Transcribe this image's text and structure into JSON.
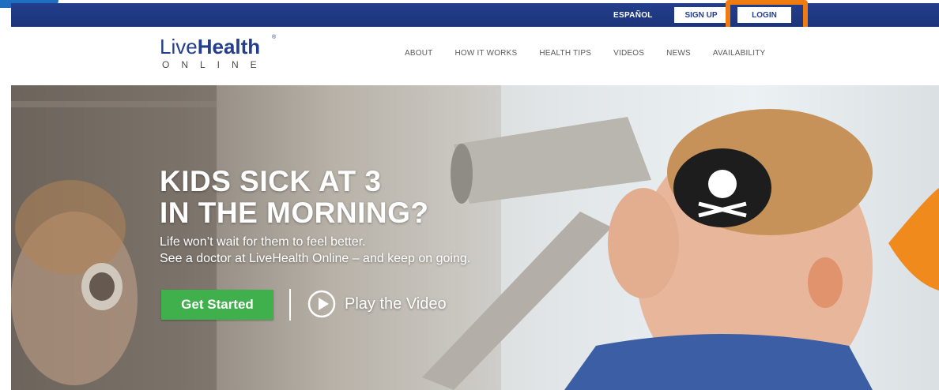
{
  "utility": {
    "espanol": "ESPAÑOL",
    "signup": "SIGN UP",
    "login": "LOGIN"
  },
  "logo": {
    "light": "Live",
    "bold": "Health",
    "registered": "®",
    "sub": "ONLINE"
  },
  "nav": {
    "items": [
      {
        "label": "ABOUT"
      },
      {
        "label": "HOW IT WORKS"
      },
      {
        "label": "HEALTH TIPS"
      },
      {
        "label": "VIDEOS"
      },
      {
        "label": "NEWS"
      },
      {
        "label": "AVAILABILITY"
      }
    ]
  },
  "hero": {
    "title_line1": "KIDS SICK AT 3",
    "title_line2": "IN THE MORNING?",
    "sub_line1": "Life won’t wait for them to feel better.",
    "sub_line2": "See a doctor at LiveHealth Online – and keep on going.",
    "cta_label": "Get Started",
    "video_label": "Play the Video"
  },
  "colors": {
    "brand_blue": "#233e8c",
    "cta_green": "#3fb04b",
    "highlight_orange": "#f07b10"
  }
}
